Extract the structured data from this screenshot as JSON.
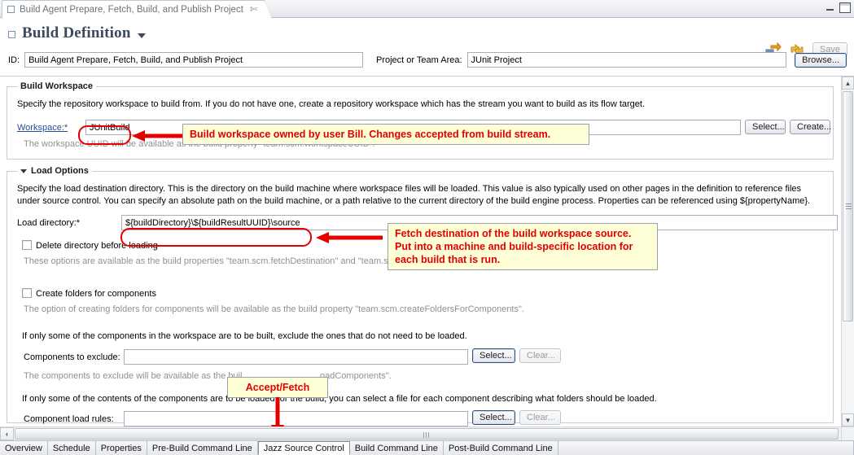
{
  "window": {
    "editor_tab_title": "Build Agent Prepare, Fetch, Build, and Publish Project",
    "close_glyph": "✄",
    "minimize_label": "minimize",
    "maximize_label": "maximize"
  },
  "header": {
    "page_title": "Build Definition",
    "id_label": "ID:",
    "id_value": "Build Agent Prepare, Fetch, Build, and Publish Project",
    "project_label": "Project or Team Area:",
    "project_value": "JUnit Project",
    "browse_label": "Browse...",
    "save_label": "Save",
    "toolbar_icons": [
      "request-build-icon",
      "refresh-icon"
    ]
  },
  "build_workspace": {
    "section_title": "Build Workspace",
    "description": "Specify the repository workspace to build from. If you do not have one, create a repository workspace which has the stream you want to build as its flow target.",
    "workspace_label": "Workspace:*",
    "workspace_value": "JUnitBuild",
    "select_label": "Select...",
    "create_label": "Create...",
    "hint": "The workspace UUID will be available as the build property \"team.scm.workspaceUUID\"."
  },
  "load_options": {
    "section_title": "Load Options",
    "description": "Specify the load destination directory. This is the directory on the build machine where workspace files will be loaded. This value is also typically used on other pages in the definition to reference files under source control. You can specify an absolute path on the build machine, or a path relative to the current directory of the build engine process. Properties can be referenced using ${propertyName}.",
    "load_dir_label": "Load directory:*",
    "load_dir_value": "${buildDirectory}\\${buildResultUUID}\\source",
    "delete_dir_checkbox": "Delete directory before loading",
    "delete_dir_hint": "These options are available as the build properties \"team.scm.fetchDestination\" and \"team.scm",
    "create_folders_checkbox": "Create folders for components",
    "create_folders_hint": "The option of creating folders for components will be available as the build property \"team.scm.createFoldersForComponents\".",
    "exclude_intro": "If only some of the components in the workspace are to be built, exclude the ones that do not need to be loaded.",
    "exclude_label": "Components to exclude:",
    "exclude_value": "",
    "exclude_select": "Select...",
    "exclude_clear": "Clear...",
    "exclude_hint_left": "The components to exclude will be available as the buil",
    "exclude_hint_right": "oadComponents\".",
    "load_rules_intro": "If only some of the contents of the components are to be loaded for the build, you can select a file for each component describing what folders should be loaded.",
    "load_rules_label": "Component load rules:",
    "load_rules_value": "",
    "load_rules_select": "Select...",
    "load_rules_clear": "Clear..."
  },
  "annotations": [
    {
      "id": "workspace-note",
      "text": "Build workspace owned by user Bill.   Changes accepted from build stream."
    },
    {
      "id": "fetch-note",
      "text": "Fetch destination of the build workspace source.\nPut into a machine and build-specific location for\neach build that is run."
    },
    {
      "id": "accept-fetch-note",
      "text": "Accept/Fetch"
    }
  ],
  "page_tabs": {
    "items": [
      {
        "label": "Overview",
        "active": false
      },
      {
        "label": "Schedule",
        "active": false
      },
      {
        "label": "Properties",
        "active": false
      },
      {
        "label": "Pre-Build Command Line",
        "active": false
      },
      {
        "label": "Jazz Source Control",
        "active": true
      },
      {
        "label": "Build Command Line",
        "active": false
      },
      {
        "label": "Post-Build Command Line",
        "active": false
      }
    ]
  },
  "colors": {
    "annotation_text": "#e00000",
    "annotation_bg": "#feffd7",
    "title": "#3b4a5c",
    "link": "#2a4e9b",
    "hint": "#8d9097"
  }
}
